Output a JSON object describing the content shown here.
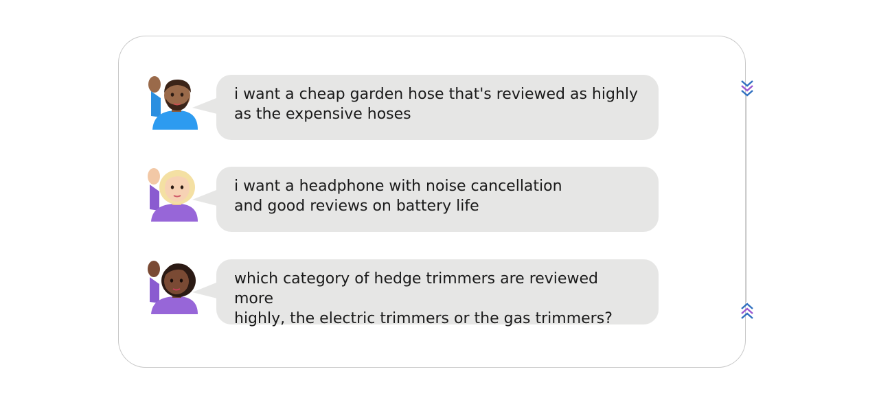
{
  "messages": [
    {
      "text": "i want a cheap garden hose that's reviewed as highly\nas the expensive hoses",
      "avatar": "man-raising-hand-icon"
    },
    {
      "text": "i want a headphone with noise cancellation\nand good reviews on battery life",
      "avatar": "woman-raising-hand-icon"
    },
    {
      "text": "which category of hedge trimmers are reviewed more\nhighly, the electric trimmers or the gas trimmers?",
      "avatar": "woman-raising-hand-icon"
    }
  ],
  "colors": {
    "bubble": "#e6e6e5",
    "card_border": "#c8c8c8",
    "chevron_blue": "#2f6fc0",
    "chevron_purple": "#9b59d0"
  },
  "controls": {
    "scroll_down": "chevron-double-down-icon",
    "scroll_up": "chevron-double-up-icon"
  }
}
